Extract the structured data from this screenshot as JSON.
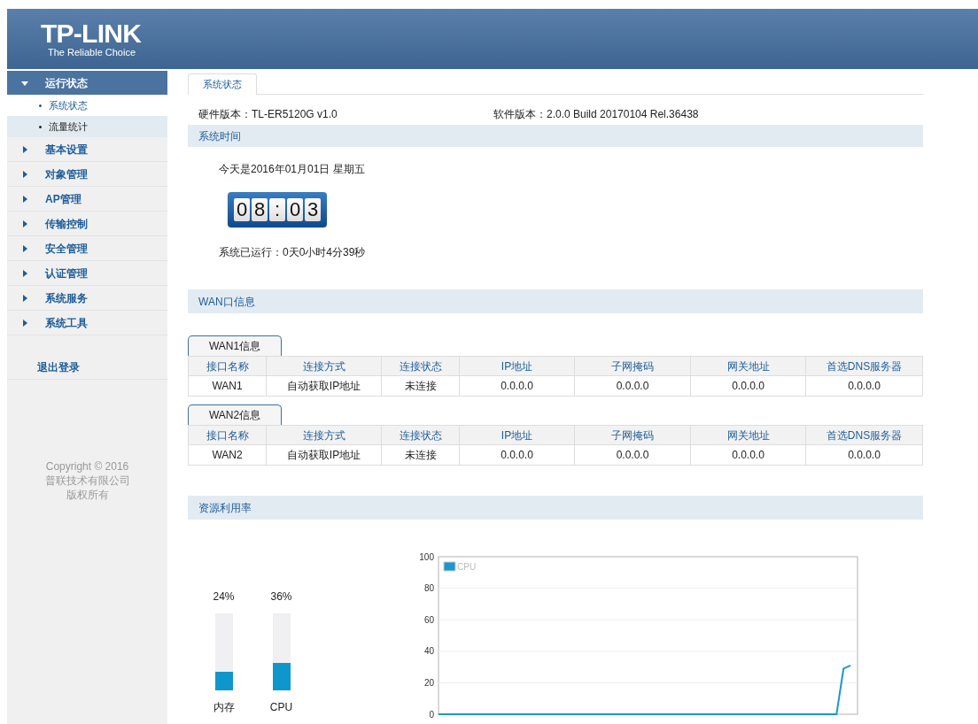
{
  "header": {
    "logo": "TP-LINK",
    "tagline": "The Reliable Choice"
  },
  "sidebar": {
    "items": [
      {
        "label": "运行状态",
        "expanded": true,
        "children": [
          {
            "label": "系统状态",
            "selected": true
          },
          {
            "label": "流量统计",
            "selected": false
          }
        ]
      },
      {
        "label": "基本设置",
        "expanded": false
      },
      {
        "label": "对象管理",
        "expanded": false
      },
      {
        "label": "AP管理",
        "expanded": false
      },
      {
        "label": "传输控制",
        "expanded": false
      },
      {
        "label": "安全管理",
        "expanded": false
      },
      {
        "label": "认证管理",
        "expanded": false
      },
      {
        "label": "系统服务",
        "expanded": false
      },
      {
        "label": "系统工具",
        "expanded": false
      }
    ],
    "logout": "退出登录",
    "copyright": [
      "Copyright © 2016",
      "普联技术有限公司",
      "版权所有"
    ]
  },
  "tabs": [
    {
      "label": "系统状态",
      "selected": true
    }
  ],
  "hardware_version": "硬件版本：TL-ER5120G v1.0",
  "software_version": "软件版本：2.0.0 Build 20170104 Rel.36438",
  "system_time": {
    "title": "系统时间",
    "date": "今天是2016年01月01日 星期五",
    "clock_digits": [
      "0",
      "8",
      ":",
      "0",
      "3"
    ],
    "uptime": "系统已运行：0天0小时4分39秒"
  },
  "wan_info": {
    "title": "WAN口信息",
    "tables": [
      {
        "tab": "WAN1信息",
        "columns": [
          "接口名称",
          "连接方式",
          "连接状态",
          "IP地址",
          "子网掩码",
          "网关地址",
          "首选DNS服务器"
        ],
        "rows": [
          [
            "WAN1",
            "自动获取IP地址",
            "未连接",
            "0.0.0.0",
            "0.0.0.0",
            "0.0.0.0",
            "0.0.0.0"
          ]
        ]
      },
      {
        "tab": "WAN2信息",
        "columns": [
          "接口名称",
          "连接方式",
          "连接状态",
          "IP地址",
          "子网掩码",
          "网关地址",
          "首选DNS服务器"
        ],
        "rows": [
          [
            "WAN2",
            "自动获取IP地址",
            "未连接",
            "0.0.0.0",
            "0.0.0.0",
            "0.0.0.0",
            "0.0.0.0"
          ]
        ]
      }
    ]
  },
  "resources": {
    "title": "资源利用率",
    "meters": [
      {
        "label": "内存",
        "reading": "24%",
        "level": 0.24
      },
      {
        "label": "CPU",
        "reading": "36%",
        "level": 0.36
      }
    ],
    "chart_data": {
      "type": "line",
      "grid": true,
      "ylim": [
        0,
        100
      ],
      "yticks": [
        0,
        20,
        40,
        60,
        80,
        100
      ],
      "categories": [
        null,
        null,
        null,
        null,
        null,
        null,
        null,
        null,
        null,
        null,
        null,
        null,
        null,
        null,
        null,
        null,
        null,
        null,
        null,
        null,
        null,
        null,
        null,
        null,
        null,
        null,
        null,
        null,
        null,
        null,
        null,
        null,
        null,
        null,
        null,
        null,
        null,
        null,
        null,
        null,
        null,
        null,
        null,
        null,
        null,
        null,
        null,
        null,
        null,
        null,
        null,
        null,
        null,
        null,
        null,
        null,
        null,
        null,
        null,
        null
      ],
      "series": [
        {
          "name": "CPU",
          "color": "#1b97cc",
          "values": [
            0,
            0,
            0,
            0,
            0,
            0,
            0,
            0,
            0,
            0,
            0,
            0,
            0,
            0,
            0,
            0,
            0,
            0,
            0,
            0,
            0,
            0,
            0,
            0,
            0,
            0,
            0,
            0,
            0,
            0,
            0,
            0,
            0,
            0,
            0,
            0,
            0,
            0,
            0,
            0,
            0,
            0,
            0,
            0,
            0,
            0,
            0,
            0,
            0,
            0,
            0,
            0,
            0,
            0,
            0,
            0,
            0,
            0,
            29,
            31
          ]
        }
      ]
    }
  }
}
